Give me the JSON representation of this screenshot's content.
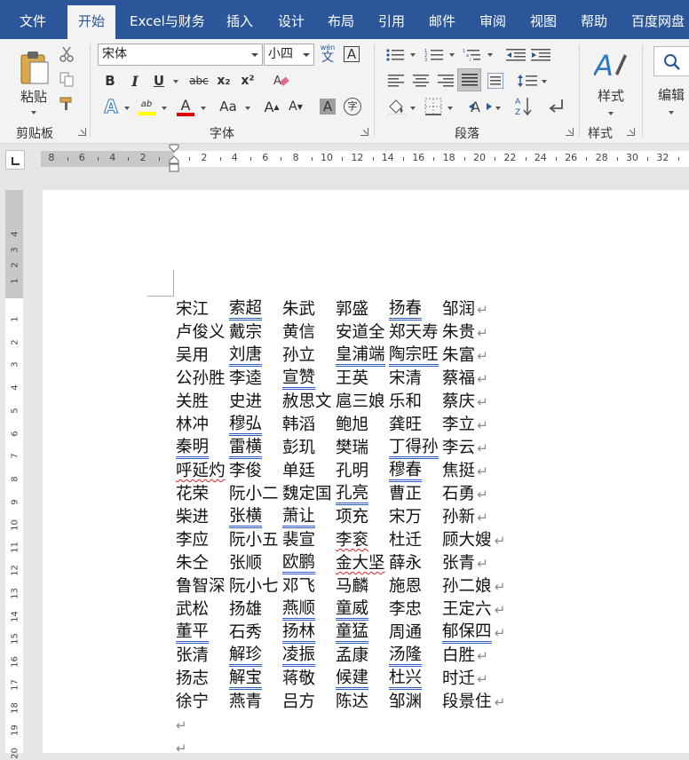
{
  "tabs": [
    {
      "label": "文件"
    },
    {
      "label": "开始"
    },
    {
      "label": "Excel与财务"
    },
    {
      "label": "插入"
    },
    {
      "label": "设计"
    },
    {
      "label": "布局"
    },
    {
      "label": "引用"
    },
    {
      "label": "邮件"
    },
    {
      "label": "审阅"
    },
    {
      "label": "视图"
    },
    {
      "label": "帮助"
    },
    {
      "label": "百度网盘"
    }
  ],
  "active_tab": "开始",
  "ribbon": {
    "clipboard": {
      "paste_label": "粘贴",
      "group_label": "剪贴板"
    },
    "font": {
      "font_name": "宋体",
      "font_size": "小四",
      "group_label": "字体",
      "wen_label": "wén",
      "wen_char": "文",
      "bold": "B",
      "italic": "I",
      "underline": "U",
      "strike": "abc",
      "sub": "x₂",
      "sup": "x²",
      "case": "Aa",
      "grow": "A",
      "shrink": "A",
      "a_char": "A",
      "ab_label": "ab",
      "circle_char": "字"
    },
    "paragraph": {
      "group_label": "段落"
    },
    "styles": {
      "label": "样式",
      "group_label": "样式"
    },
    "editing": {
      "label": "编辑"
    }
  },
  "colors": {
    "accent": "#2b579a",
    "underline": "#2e5ebf",
    "highlight": "#ffff00",
    "font_color": "#e00000"
  },
  "ruler": {
    "left_numbers": [
      "8",
      "6",
      "4",
      "2"
    ],
    "right_numbers": [
      "2",
      "4",
      "6",
      "8",
      "10",
      "12",
      "14",
      "16",
      "18",
      "20",
      "22",
      "24",
      "26",
      "28",
      "30",
      "32"
    ],
    "vertical_top": [
      "4",
      "3",
      "2",
      "1"
    ],
    "vertical_numbers": [
      "1",
      "2",
      "3",
      "4",
      "5",
      "6",
      "7",
      "8",
      "9",
      "10",
      "11",
      "12",
      "13",
      "14",
      "15",
      "16",
      "17",
      "18",
      "19",
      "20"
    ]
  },
  "document": {
    "paragraph_mark": "↵",
    "lines": [
      [
        {
          "t": "宋江"
        },
        {
          "t": "索超",
          "u": true
        },
        {
          "t": "朱武"
        },
        {
          "t": "郭盛"
        },
        {
          "t": "扬春",
          "u": true
        },
        {
          "t": "邹润"
        }
      ],
      [
        {
          "t": "卢俊义"
        },
        {
          "t": "戴宗"
        },
        {
          "t": "黄信"
        },
        {
          "t": "安道全"
        },
        {
          "t": "郑天寿"
        },
        {
          "t": "朱贵"
        }
      ],
      [
        {
          "t": "吴用"
        },
        {
          "t": "刘唐",
          "u": true
        },
        {
          "t": "孙立"
        },
        {
          "t": "皇浦端",
          "u": true
        },
        {
          "t": "陶宗旺",
          "u": true
        },
        {
          "t": "朱富"
        }
      ],
      [
        {
          "t": "公孙胜"
        },
        {
          "t": "李逵"
        },
        {
          "t": "宣赞",
          "u": true
        },
        {
          "t": "王英"
        },
        {
          "t": "宋清"
        },
        {
          "t": "蔡福"
        }
      ],
      [
        {
          "t": "关胜"
        },
        {
          "t": "史进"
        },
        {
          "t": "赦思文"
        },
        {
          "t": "扈三娘"
        },
        {
          "t": "乐和"
        },
        {
          "t": "蔡庆"
        }
      ],
      [
        {
          "t": "林冲"
        },
        {
          "t": "穆弘",
          "u": true
        },
        {
          "t": "韩滔"
        },
        {
          "t": "鲍旭"
        },
        {
          "t": "龚旺"
        },
        {
          "t": "李立"
        }
      ],
      [
        {
          "t": "秦明",
          "u": true
        },
        {
          "t": "雷横",
          "u": true
        },
        {
          "t": "彭玑"
        },
        {
          "t": "樊瑞"
        },
        {
          "t": "丁得孙",
          "u": true
        },
        {
          "t": "李云"
        }
      ],
      [
        {
          "t": "呼延灼",
          "w": true
        },
        {
          "t": "李俊"
        },
        {
          "t": "单廷"
        },
        {
          "t": "孔明"
        },
        {
          "t": "穆春",
          "u": true
        },
        {
          "t": "焦挺"
        }
      ],
      [
        {
          "t": "花荣"
        },
        {
          "t": "阮小二"
        },
        {
          "t": "魏定国"
        },
        {
          "t": "孔亮",
          "u": true
        },
        {
          "t": "曹正"
        },
        {
          "t": "石勇"
        }
      ],
      [
        {
          "t": "柴进"
        },
        {
          "t": "张横",
          "u": true
        },
        {
          "t": "萧让",
          "u": true
        },
        {
          "t": "项充"
        },
        {
          "t": "宋万"
        },
        {
          "t": "孙新"
        }
      ],
      [
        {
          "t": "李应"
        },
        {
          "t": "阮小五"
        },
        {
          "t": "裴宣"
        },
        {
          "t": "李衮",
          "w": true
        },
        {
          "t": "杜迁"
        },
        {
          "t": "顾大嫂"
        }
      ],
      [
        {
          "t": "朱仝"
        },
        {
          "t": "张顺"
        },
        {
          "t": "欧鹏",
          "u": true
        },
        {
          "t": "金大坚",
          "w": true
        },
        {
          "t": "薛永"
        },
        {
          "t": "张青"
        }
      ],
      [
        {
          "t": "鲁智深"
        },
        {
          "t": "阮小七"
        },
        {
          "t": "邓飞"
        },
        {
          "t": "马麟"
        },
        {
          "t": "施恩"
        },
        {
          "t": "孙二娘"
        }
      ],
      [
        {
          "t": "武松"
        },
        {
          "t": "扬雄"
        },
        {
          "t": "燕顺",
          "u": true
        },
        {
          "t": "童威",
          "u": true
        },
        {
          "t": "李忠"
        },
        {
          "t": "王定六"
        }
      ],
      [
        {
          "t": "董平",
          "u": true
        },
        {
          "t": "石秀"
        },
        {
          "t": "扬林",
          "u": true
        },
        {
          "t": "童猛",
          "u": true
        },
        {
          "t": "周通"
        },
        {
          "t": "郁保四",
          "u": true
        }
      ],
      [
        {
          "t": "张清"
        },
        {
          "t": "解珍",
          "u": true
        },
        {
          "t": "凌振",
          "u": true
        },
        {
          "t": "孟康"
        },
        {
          "t": "汤隆",
          "u": true
        },
        {
          "t": "白胜"
        }
      ],
      [
        {
          "t": "扬志"
        },
        {
          "t": "解宝",
          "u": true
        },
        {
          "t": "蒋敬"
        },
        {
          "t": "候建",
          "u": true
        },
        {
          "t": "杜兴",
          "u": true
        },
        {
          "t": "时迁"
        }
      ],
      [
        {
          "t": "徐宁"
        },
        {
          "t": "燕青"
        },
        {
          "t": "吕方"
        },
        {
          "t": "陈达"
        },
        {
          "t": "邹渊"
        },
        {
          "t": "段景住"
        }
      ],
      [],
      []
    ]
  }
}
